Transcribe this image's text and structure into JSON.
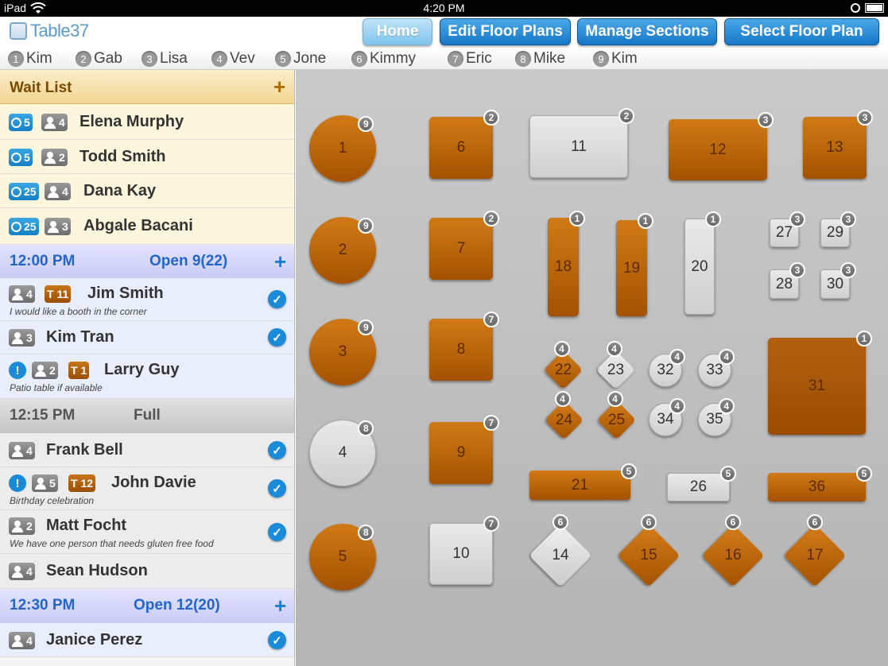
{
  "status_bar": {
    "carrier": "iPad",
    "time": "4:20 PM"
  },
  "app": {
    "logo_text": "Table37"
  },
  "nav": {
    "home": "Home",
    "edit": "Edit Floor Plans",
    "manage": "Manage Sections",
    "select": "Select Floor Plan"
  },
  "servers": [
    {
      "num": "1",
      "name": "Kim"
    },
    {
      "num": "2",
      "name": "Gab"
    },
    {
      "num": "3",
      "name": "Lisa"
    },
    {
      "num": "4",
      "name": "Vev"
    },
    {
      "num": "5",
      "name": "Jone"
    },
    {
      "num": "6",
      "name": "Kimmy"
    },
    {
      "num": "7",
      "name": "Eric"
    },
    {
      "num": "8",
      "name": "Mike"
    },
    {
      "num": "9",
      "name": "Kim"
    }
  ],
  "wait_list": {
    "title": "Wait List",
    "add": "+",
    "entries": [
      {
        "wait": "5",
        "party": "4",
        "name": "Elena Murphy"
      },
      {
        "wait": "5",
        "party": "2",
        "name": "Todd Smith"
      },
      {
        "wait": "25",
        "party": "4",
        "name": "Dana Kay"
      },
      {
        "wait": "25",
        "party": "3",
        "name": "Abgale Bacani"
      }
    ]
  },
  "slots": [
    {
      "time": "12:00 PM",
      "status": "Open 9(22)",
      "add": "+",
      "entries": [
        {
          "party": "4",
          "table": "T 11",
          "name": "Jim Smith",
          "note": "I would like a booth in the corner",
          "checked": true
        },
        {
          "party": "3",
          "name": "Kim Tran",
          "checked": true
        },
        {
          "alert": "!",
          "party": "2",
          "table": "T 1",
          "name": "Larry Guy",
          "note": "Patio table if available"
        }
      ]
    },
    {
      "time": "12:15 PM",
      "status": "Full",
      "entries": [
        {
          "party": "4",
          "name": "Frank Bell",
          "checked": true
        },
        {
          "alert": "!",
          "party": "5",
          "table": "T 12",
          "name": "John Davie",
          "note": "Birthday celebration",
          "checked": true
        },
        {
          "party": "2",
          "name": "Matt Focht",
          "note": "We have one person that needs gluten free food",
          "checked": true
        },
        {
          "party": "4",
          "name": "Sean Hudson"
        }
      ]
    },
    {
      "time": "12:30 PM",
      "status": "Open 12(20)",
      "add": "+",
      "entries": [
        {
          "party": "4",
          "name": "Janice Perez",
          "checked": true
        }
      ]
    }
  ],
  "check_glyph": "✓",
  "tables": [
    {
      "num": "1",
      "cap": "9",
      "shape": "circle",
      "color": "orange"
    },
    {
      "num": "2",
      "cap": "9",
      "shape": "circle",
      "color": "orange"
    },
    {
      "num": "3",
      "cap": "9",
      "shape": "circle",
      "color": "orange"
    },
    {
      "num": "4",
      "cap": "8",
      "shape": "circle",
      "color": "gray"
    },
    {
      "num": "5",
      "cap": "8",
      "shape": "circle",
      "color": "orange"
    },
    {
      "num": "6",
      "cap": "2",
      "shape": "rect",
      "color": "orange"
    },
    {
      "num": "7",
      "cap": "2",
      "shape": "rect",
      "color": "orange"
    },
    {
      "num": "8",
      "cap": "7",
      "shape": "rect",
      "color": "orange"
    },
    {
      "num": "9",
      "cap": "7",
      "shape": "rect",
      "color": "orange"
    },
    {
      "num": "10",
      "cap": "7",
      "shape": "rect",
      "color": "gray"
    },
    {
      "num": "11",
      "cap": "2",
      "shape": "rect",
      "color": "gray"
    },
    {
      "num": "12",
      "cap": "3",
      "shape": "rect",
      "color": "orange"
    },
    {
      "num": "13",
      "cap": "3",
      "shape": "rect",
      "color": "orange"
    },
    {
      "num": "14",
      "cap": "6",
      "shape": "diamond",
      "color": "gray"
    },
    {
      "num": "15",
      "cap": "6",
      "shape": "diamond",
      "color": "orange"
    },
    {
      "num": "16",
      "cap": "6",
      "shape": "diamond",
      "color": "orange"
    },
    {
      "num": "17",
      "cap": "6",
      "shape": "diamond",
      "color": "orange"
    },
    {
      "num": "18",
      "cap": "1",
      "shape": "rect",
      "color": "orange"
    },
    {
      "num": "19",
      "cap": "1",
      "shape": "rect",
      "color": "orange"
    },
    {
      "num": "20",
      "cap": "1",
      "shape": "rect",
      "color": "gray"
    },
    {
      "num": "21",
      "cap": "5",
      "shape": "rect",
      "color": "orange"
    },
    {
      "num": "22",
      "cap": "4",
      "shape": "diamond",
      "color": "orange"
    },
    {
      "num": "23",
      "cap": "4",
      "shape": "diamond",
      "color": "gray"
    },
    {
      "num": "24",
      "cap": "4",
      "shape": "diamond",
      "color": "orange"
    },
    {
      "num": "25",
      "cap": "4",
      "shape": "diamond",
      "color": "orange"
    },
    {
      "num": "26",
      "cap": "5",
      "shape": "rect",
      "color": "gray"
    },
    {
      "num": "27",
      "cap": "3",
      "shape": "rect",
      "color": "gray"
    },
    {
      "num": "28",
      "cap": "3",
      "shape": "rect",
      "color": "gray"
    },
    {
      "num": "29",
      "cap": "3",
      "shape": "rect",
      "color": "gray"
    },
    {
      "num": "30",
      "cap": "3",
      "shape": "rect",
      "color": "gray"
    },
    {
      "num": "31",
      "cap": "1",
      "shape": "rect",
      "color": "dark-orange"
    },
    {
      "num": "32",
      "cap": "4",
      "shape": "circle",
      "color": "gray"
    },
    {
      "num": "33",
      "cap": "4",
      "shape": "circle",
      "color": "gray"
    },
    {
      "num": "34",
      "cap": "4",
      "shape": "circle",
      "color": "gray"
    },
    {
      "num": "35",
      "cap": "4",
      "shape": "circle",
      "color": "gray"
    },
    {
      "num": "36",
      "cap": "5",
      "shape": "rect",
      "color": "orange"
    }
  ],
  "colors": {
    "orange": "#c06a10",
    "gray": "#dcdcdc",
    "dark-orange": "#a85600",
    "accent_blue": "#1a8bd8"
  }
}
